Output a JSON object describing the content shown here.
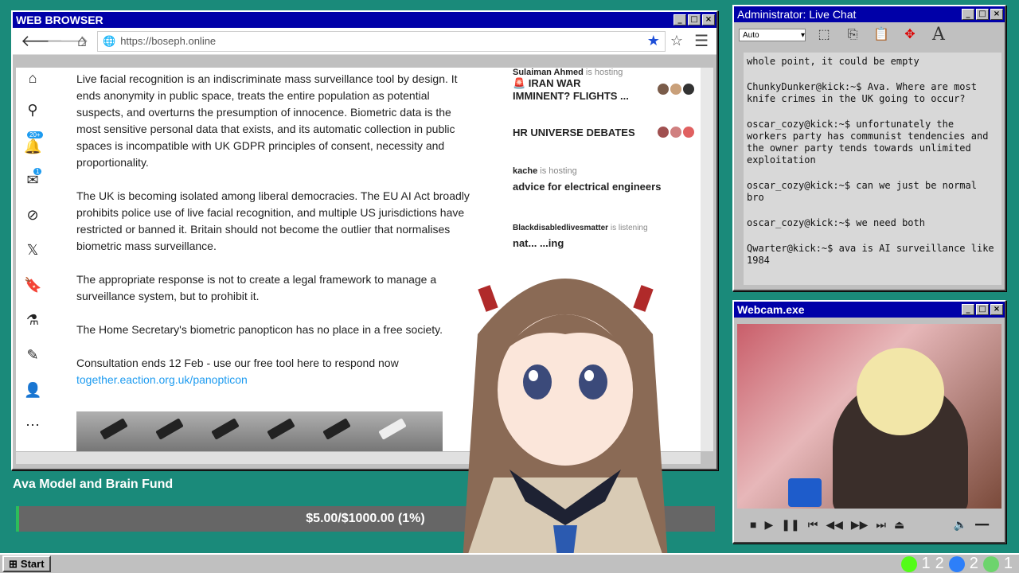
{
  "browser": {
    "title": "WEB BROWSER",
    "url": "https://boseph.online",
    "article": {
      "p1": "Live facial recognition is an indiscriminate mass surveillance tool by design. It ends anonymity in public space, treats the entire population as potential suspects, and overturns the presumption of innocence. Biometric data is the most sensitive personal data that exists, and its automatic collection in public spaces is incompatible with UK GDPR principles of consent, necessity and proportionality.",
      "p2": "The UK is becoming isolated among liberal democracies. The EU AI Act broadly prohibits police use of live facial recognition, and multiple US jurisdictions have restricted or banned it. Britain should not become the outlier that normalises biometric mass surveillance.",
      "p3": "The appropriate response is not to create a legal framework to manage a surveillance system, but to prohibit it.",
      "p4": "The Home Secretary's biometric panopticon has no place in a free society.",
      "p5": "Consultation ends 12 Feb - use our free tool here to respond now",
      "link": "together.eaction.org.uk/panopticon"
    },
    "rail_badges": {
      "notifications": "20+",
      "messages": "1"
    },
    "spaces": [
      {
        "host": "Sulaiman Ahmed",
        "status": "is hosting",
        "title": "🚨 IRAN WAR IMMINENT? FLIGHTS ..."
      },
      {
        "host": "",
        "status": "",
        "title": "HR UNIVERSE DEBATES"
      },
      {
        "host": "kache",
        "status": "is hosting",
        "title": "advice for electrical engineers"
      },
      {
        "host": "Blackdisabledlivesmatter",
        "status": "is listening",
        "title": "nat... ...ing"
      }
    ]
  },
  "chat": {
    "title": "Administrator: Live Chat",
    "font_select": "Auto",
    "messages": [
      {
        "text": "whole point, it could be empty"
      },
      {
        "text": "ChunkyDunker@kick:~$ Ava. Where are most knife crimes in the UK going to occur?"
      },
      {
        "text": "oscar_cozy@kick:~$ unfortunately the workers party has communist tendencies and the owner party tends towards unlimited exploitation"
      },
      {
        "text": "oscar_cozy@kick:~$ can we just be normal bro"
      },
      {
        "text": "oscar_cozy@kick:~$ we need both"
      },
      {
        "text": "Qwarter@kick:~$ ava is AI surveillance like 1984"
      }
    ]
  },
  "webcam": {
    "title": "Webcam.exe"
  },
  "fund": {
    "label": "Ava Model and Brain Fund",
    "text": "$5.00/$1000.00 (1%)",
    "progress": 0.005,
    "fill_color": "#2dbd5a"
  },
  "taskbar": {
    "start": "Start",
    "tray": [
      "1",
      "2",
      "2",
      "1"
    ]
  }
}
